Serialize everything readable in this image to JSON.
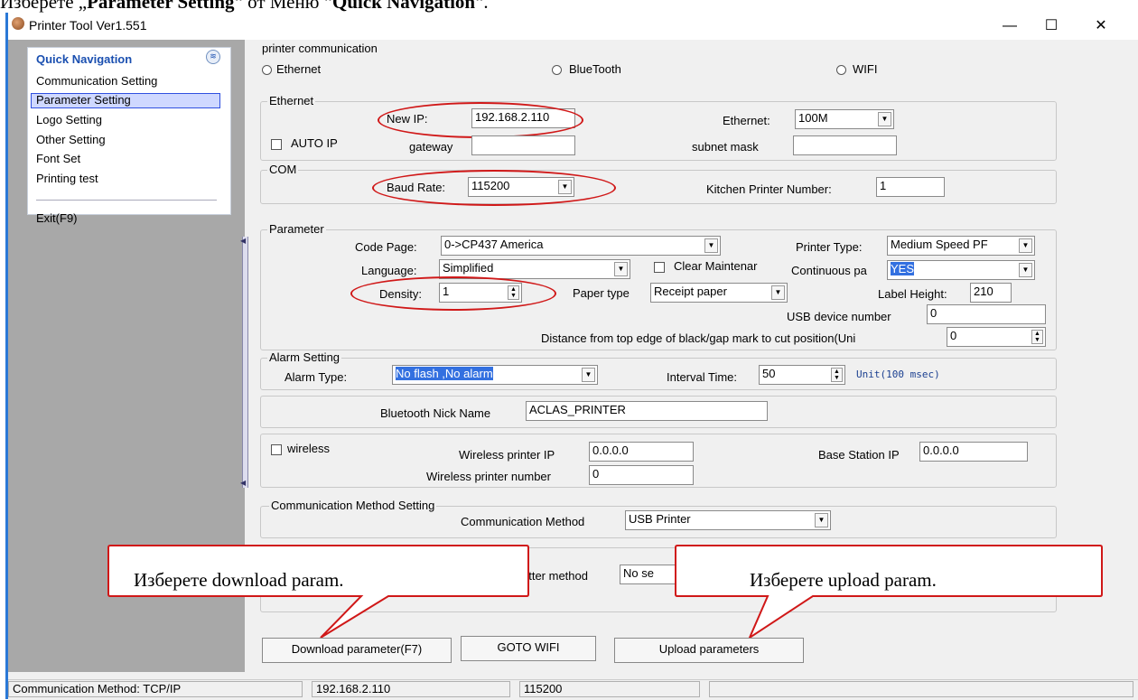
{
  "doc": {
    "prefix": "Изберете „",
    "bold1": "Parameter Setting",
    "mid": "“ от Меню “",
    "bold2": "Quick Navigation",
    "suffix": "“."
  },
  "window": {
    "title": "Printer Tool Ver1.551",
    "minimize": "—",
    "maximize": "☐",
    "close": "✕"
  },
  "quick_nav": {
    "header": "Quick Navigation",
    "collapse_glyph": "≋",
    "items": [
      "Communication Setting",
      "Parameter Setting",
      "Logo Setting",
      "Other Setting",
      "Font Set",
      "Printing test"
    ],
    "exit": "Exit(F9)"
  },
  "comm": {
    "legend": "printer communication",
    "ethernet": "Ethernet",
    "bluetooth": "BlueTooth",
    "wifi": "WIFI"
  },
  "ethernet": {
    "legend": "Ethernet",
    "new_ip_label": "New IP:",
    "new_ip": "192.168.2.110",
    "ethernet_label": "Ethernet:",
    "ethernet_value": "100M",
    "auto_ip": "AUTO IP",
    "gateway_label": "gateway",
    "gateway": "",
    "subnet_label": "subnet mask",
    "subnet": ""
  },
  "com": {
    "legend": "COM",
    "baud_label": "Baud Rate:",
    "baud": "115200",
    "kitchen_label": "Kitchen Printer Number:",
    "kitchen": "1"
  },
  "parameter": {
    "legend": "Parameter",
    "code_page_label": "Code Page:",
    "code_page": "0->CP437 America",
    "printer_type_label": "Printer Type:",
    "printer_type": "Medium Speed PF",
    "language_label": "Language:",
    "language": "Simplified",
    "clear_label": "Clear Maintenar",
    "continuous_label": "Continuous pa",
    "continuous": "YES",
    "density_label": "Density:",
    "density": "1",
    "paper_type_label": "Paper type",
    "paper_type": "Receipt paper",
    "label_height_label": "Label Height:",
    "label_height": "210",
    "usb_label": "USB device number",
    "usb": "0",
    "distance_label": "Distance from top edge of black/gap mark to cut position(Uni",
    "distance": "0"
  },
  "alarm": {
    "legend": "Alarm Setting",
    "type_label": "Alarm Type:",
    "type": "No flash ,No alarm",
    "interval_label": "Interval Time:",
    "interval": "50",
    "unit": "Unit(100  msec)"
  },
  "bluetooth": {
    "nick_label": "Bluetooth Nick Name",
    "nick": "ACLAS_PRINTER"
  },
  "wireless": {
    "label": "wireless",
    "ip_label": "Wireless printer IP",
    "ip": "0.0.0.0",
    "base_label": "Base Station IP",
    "base": "0.0.0.0",
    "num_label": "Wireless printer number",
    "num": "0"
  },
  "method": {
    "legend": "Communication Method Setting",
    "label": "Communication Method",
    "value": "USB Printer"
  },
  "cutter": {
    "label": "utter method",
    "value": "No se"
  },
  "buttons": {
    "download": "Download parameter(F7)",
    "goto_wifi": "GOTO WIFI",
    "upload": "Upload parameters"
  },
  "callouts": {
    "download": "Изберете download param.",
    "upload": "Изберете upload param."
  },
  "status": {
    "method": "Communication Method: TCP/IP",
    "ip": "192.168.2.110",
    "baud": "115200"
  },
  "colors": {
    "accent": "#2a78d6",
    "annotation": "#d01818",
    "selection": "#3050e0"
  }
}
